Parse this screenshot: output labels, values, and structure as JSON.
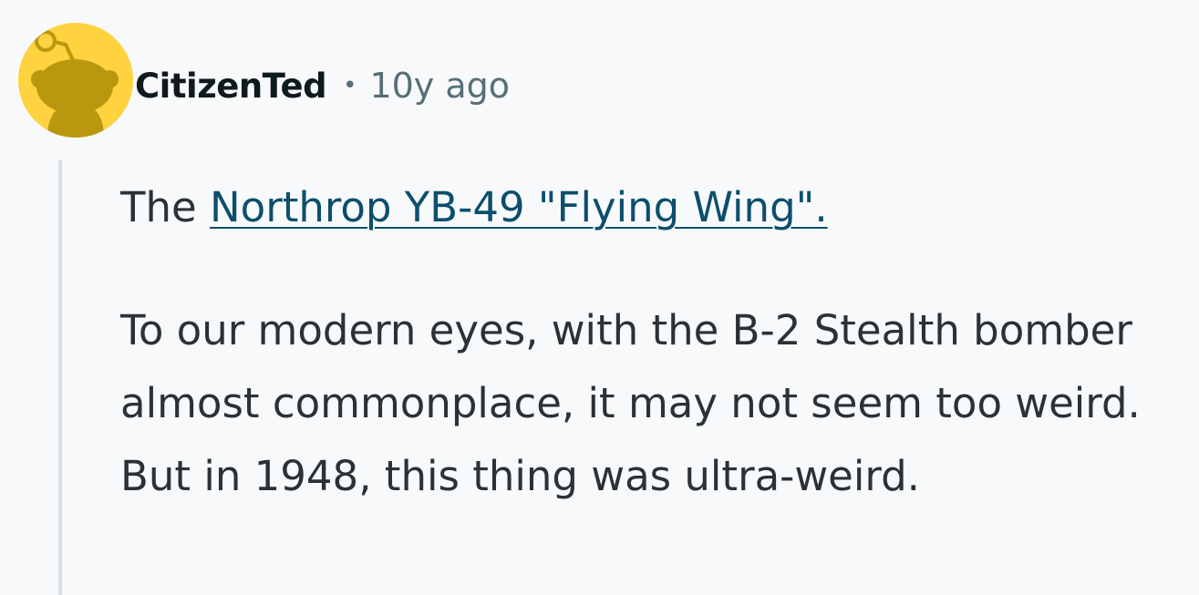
{
  "comment": {
    "author": "CitizenTed",
    "separator": "•",
    "timestamp": "10y ago",
    "avatar_icon": "snoo-avatar-icon",
    "avatar_color": "#ffd23f",
    "body": {
      "intro_text": "The ",
      "link_text": "Northrop YB-49 \"Flying Wing\".",
      "paragraph_2": "To our modern eyes, with the B-2 Stealth bomber almost commonplace, it may not seem too weird. But in 1948, this thing was ultra-weird."
    }
  }
}
